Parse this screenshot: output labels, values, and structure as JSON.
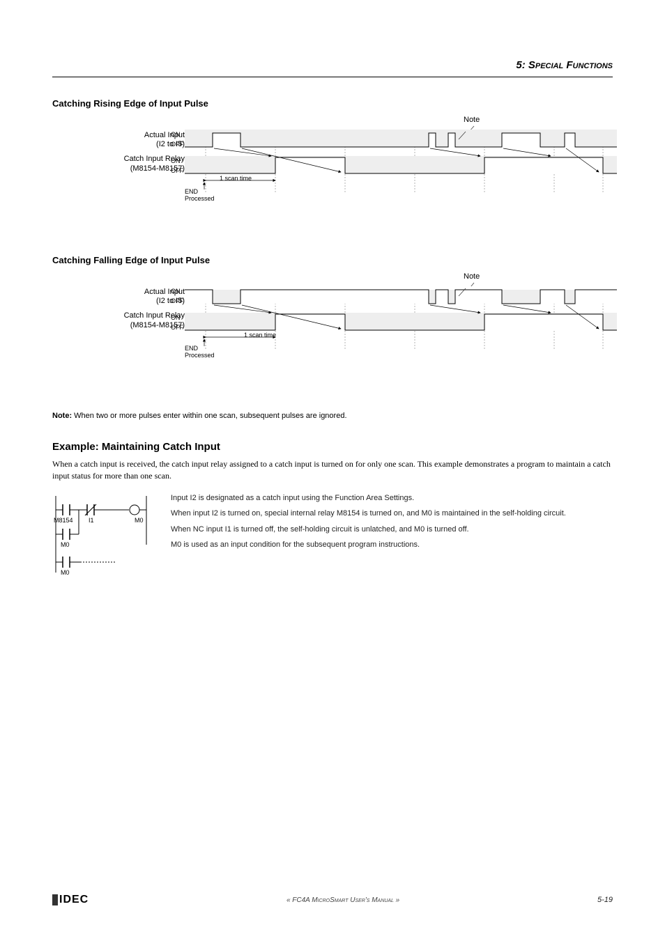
{
  "header": {
    "chapter_num": "5:",
    "chapter_title": "Special Functions"
  },
  "diagram1": {
    "title": "Catching Rising Edge of Input Pulse",
    "signal1_label": "Actual Input",
    "signal1_range": "(I2 to I5)",
    "signal2_label": "Catch Input Relay",
    "signal2_range": "(M8154-M8157)",
    "on": "ON",
    "off": "OFF",
    "note": "Note",
    "end": "END",
    "processed": "Processed",
    "scan_time": "1 scan time"
  },
  "diagram2": {
    "title": "Catching Falling Edge of Input Pulse",
    "signal1_label": "Actual Input",
    "signal1_range": "(I2 to I5)",
    "signal2_label": "Catch Input Relay",
    "signal2_range": "(M8154-M8157)",
    "on": "ON",
    "off": "OFF",
    "note": "Note",
    "end": "END",
    "processed": "Processed",
    "scan_time": "1 scan time"
  },
  "note": {
    "bold": "Note:",
    "text": " When two or more pulses enter within one scan, subsequent pulses are ignored."
  },
  "example": {
    "title": "Example: Maintaining Catch Input",
    "intro": "When a catch input is received, the catch input relay assigned to a catch input is turned on for only one scan. This example demonstrates a program to maintain a catch input status for more than one scan.",
    "ladder": {
      "m8154": "M8154",
      "i1": "I1",
      "m0_coil": "M0",
      "m0_contact": "M0",
      "m0_start": "M0"
    },
    "p1": "Input I2 is designated as a catch input using the Function Area Settings.",
    "p2": "When input I2 is turned on, special internal relay M8154 is turned on, and M0 is maintained in the self-holding circuit.",
    "p3": "When NC input I1 is turned off, the self-holding circuit is unlatched, and M0 is turned off.",
    "p4": "M0 is used as an input condition for the subsequent program instructions."
  },
  "footer": {
    "title": "« FC4A MicroSmart User's Manual »",
    "page": "5-19",
    "logo": "IDEC"
  }
}
